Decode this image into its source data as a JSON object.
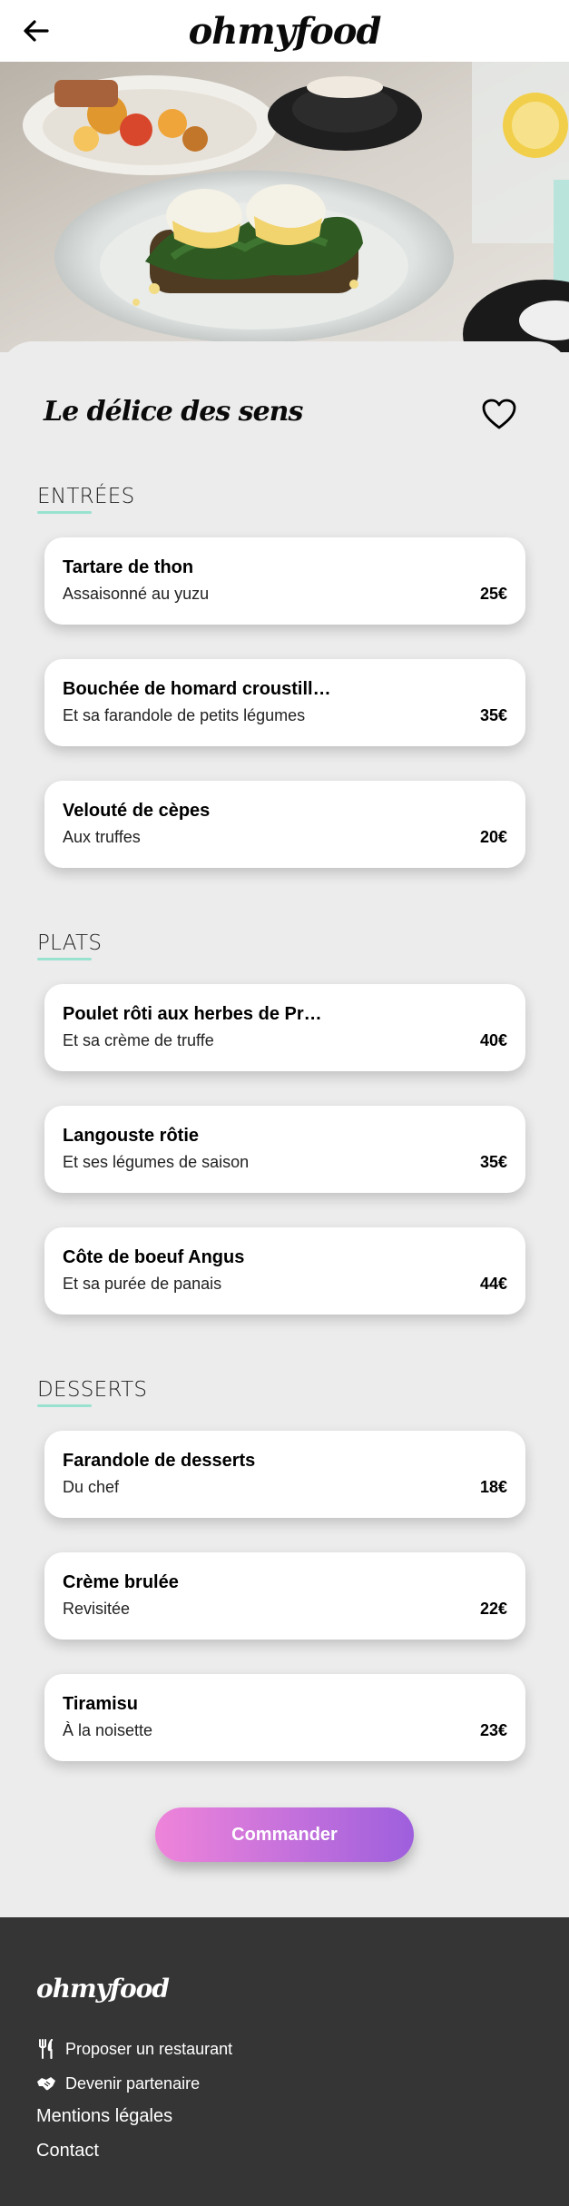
{
  "header": {
    "back_icon": "arrow-left-icon",
    "logo": "ohmyfood"
  },
  "hero": {
    "image": "food-photo"
  },
  "restaurant": {
    "name": "Le délice des sens",
    "favorite_icon": "heart-outline-icon"
  },
  "sections": [
    {
      "title": "ENTRÉES",
      "dishes": [
        {
          "name": "Tartare de thon",
          "description": "Assaisonné au yuzu",
          "price": "25€"
        },
        {
          "name": "Bouchée de homard croustill…",
          "description": "Et sa farandole de petits légumes",
          "price": "35€"
        },
        {
          "name": "Velouté de cèpes",
          "description": "Aux truffes",
          "price": "20€"
        }
      ]
    },
    {
      "title": "PLATS",
      "dishes": [
        {
          "name": "Poulet rôti aux herbes de Pr…",
          "description": "Et sa crème de truffe",
          "price": "40€"
        },
        {
          "name": "Langouste rôtie",
          "description": "Et ses légumes de saison",
          "price": "35€"
        },
        {
          "name": "Côte de boeuf Angus",
          "description": "Et sa purée de panais",
          "price": "44€"
        }
      ]
    },
    {
      "title": "DESSERTS",
      "dishes": [
        {
          "name": "Farandole de desserts",
          "description": "Du chef",
          "price": "18€"
        },
        {
          "name": "Crème brulée",
          "description": "Revisitée",
          "price": "22€"
        },
        {
          "name": "Tiramisu",
          "description": "À la noisette",
          "price": "23€"
        }
      ]
    }
  ],
  "order_button": "Commander",
  "footer": {
    "logo": "ohmyfood",
    "links": [
      {
        "label": "Proposer un restaurant",
        "icon": "utensils-icon"
      },
      {
        "label": "Devenir partenaire",
        "icon": "handshake-icon"
      },
      {
        "label": "Mentions légales"
      },
      {
        "label": "Contact"
      }
    ]
  },
  "colors": {
    "accent_underline": "#99e2d0",
    "button_gradient_start": "#ef84da",
    "button_gradient_end": "#9e5fdd",
    "footer_bg": "#353535",
    "page_bg": "#ececec"
  }
}
